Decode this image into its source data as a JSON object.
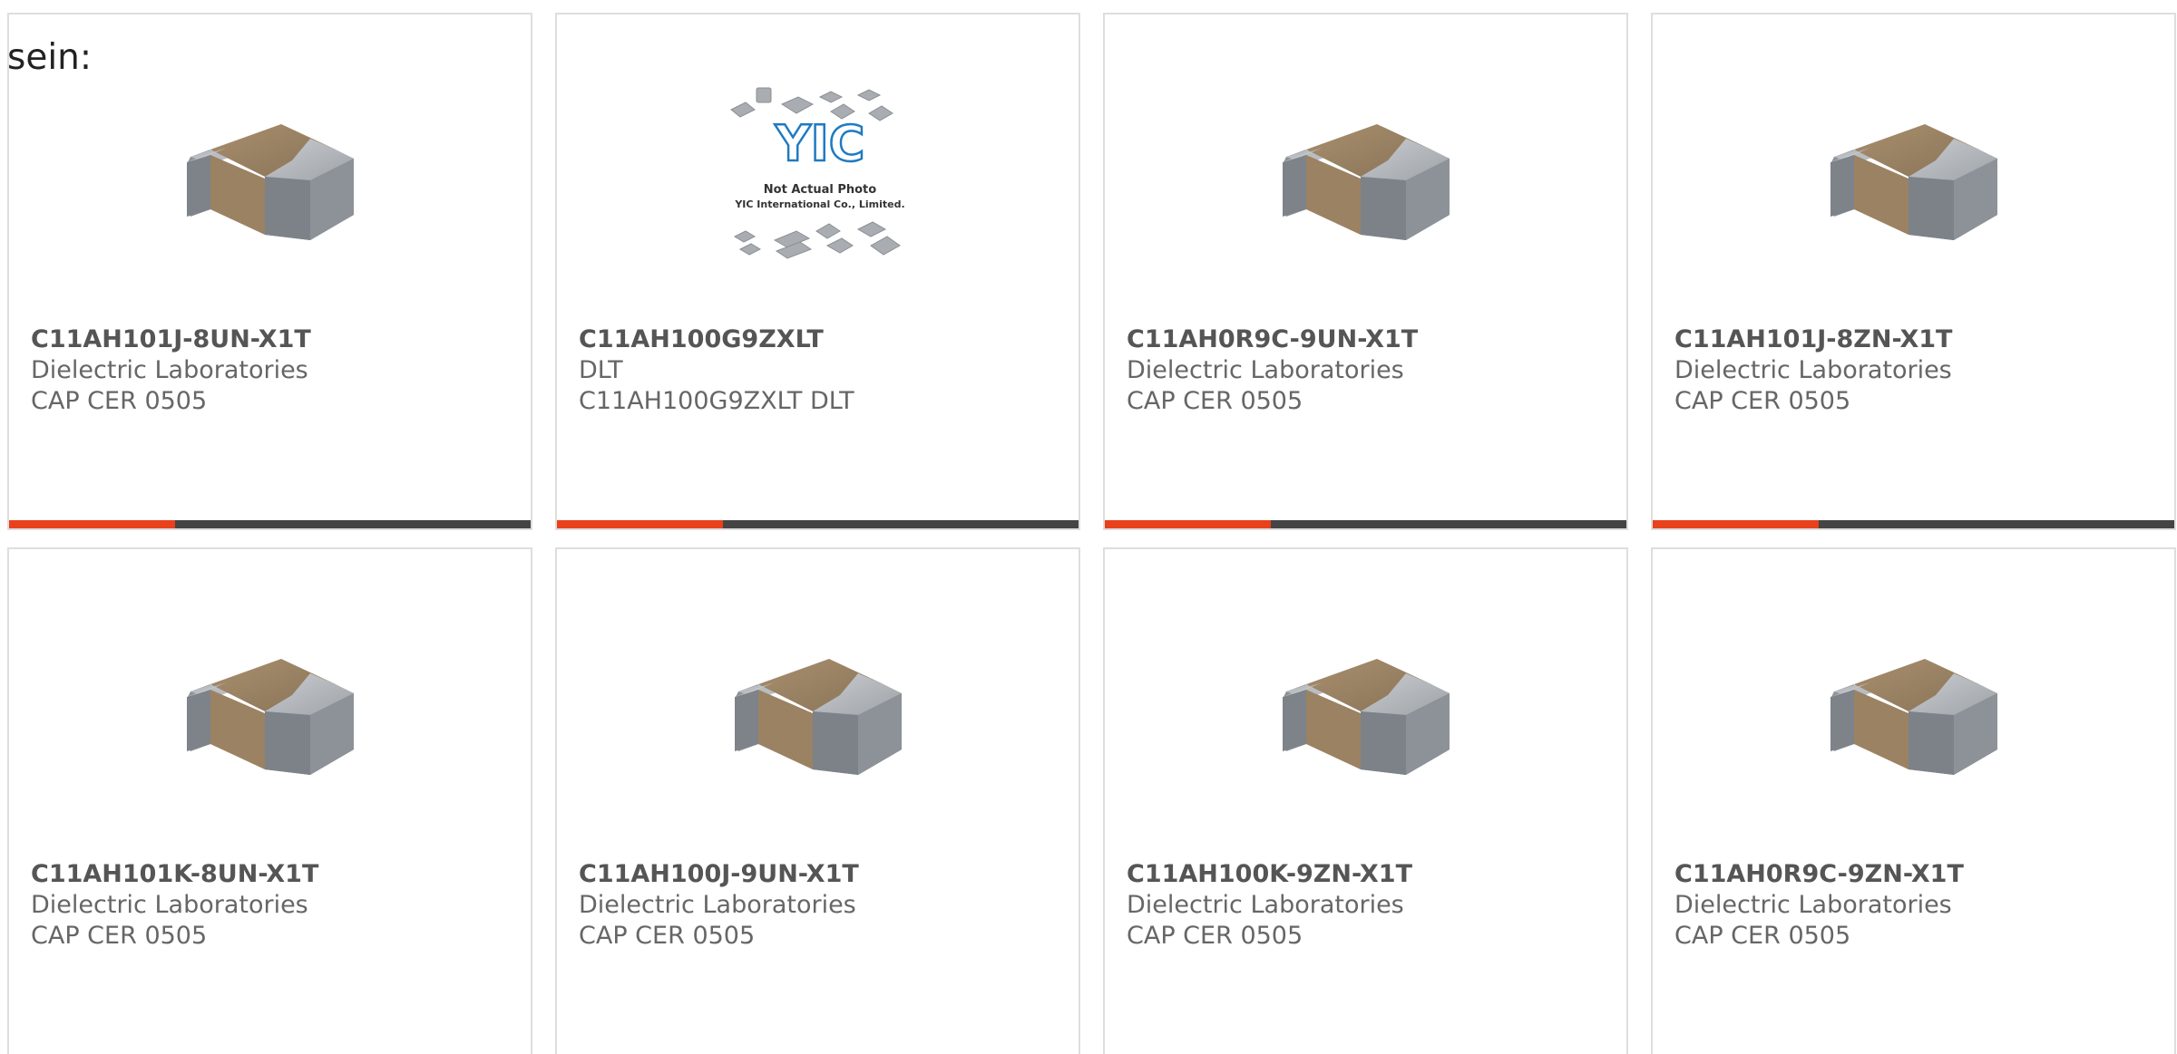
{
  "intro_text": "sein:",
  "colors": {
    "accent": "#e8411b",
    "bar": "#444444",
    "border": "#dedede"
  },
  "products": [
    {
      "part": "C11AH101J-8UN-X1T",
      "maker": "Dielectric Laboratories",
      "desc": "CAP CER 0505",
      "image": "capacitor-chip"
    },
    {
      "part": "C11AH100G9ZXLT",
      "maker": "DLT",
      "desc": "C11AH100G9ZXLT DLT",
      "image": "placeholder-yic",
      "placeholder_brand": "YIC",
      "placeholder_line1": "Not Actual Photo",
      "placeholder_line2": "YIC International Co., Limited."
    },
    {
      "part": "C11AH0R9C-9UN-X1T",
      "maker": "Dielectric Laboratories",
      "desc": "CAP CER 0505",
      "image": "capacitor-chip"
    },
    {
      "part": "C11AH101J-8ZN-X1T",
      "maker": "Dielectric Laboratories",
      "desc": "CAP CER 0505",
      "image": "capacitor-chip"
    },
    {
      "part": "C11AH101K-8UN-X1T",
      "maker": "Dielectric Laboratories",
      "desc": "CAP CER 0505",
      "image": "capacitor-chip"
    },
    {
      "part": "C11AH100J-9UN-X1T",
      "maker": "Dielectric Laboratories",
      "desc": "CAP CER 0505",
      "image": "capacitor-chip"
    },
    {
      "part": "C11AH100K-9ZN-X1T",
      "maker": "Dielectric Laboratories",
      "desc": "CAP CER 0505",
      "image": "capacitor-chip"
    },
    {
      "part": "C11AH0R9C-9ZN-X1T",
      "maker": "Dielectric Laboratories",
      "desc": "CAP CER 0505",
      "image": "capacitor-chip"
    }
  ]
}
